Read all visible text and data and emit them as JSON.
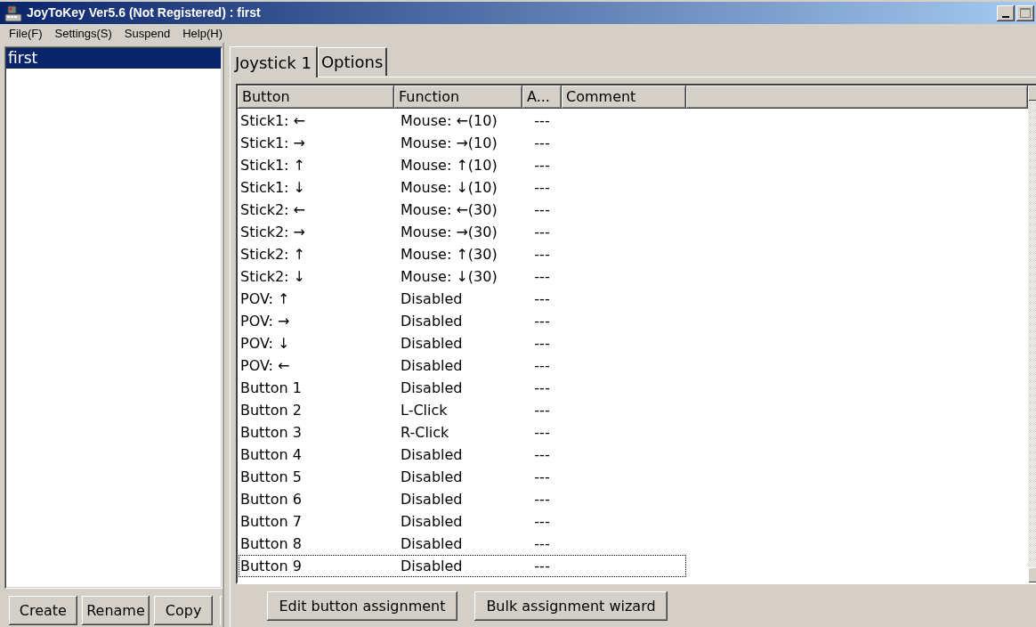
{
  "window": {
    "title": "JoyToKey Ver5.6 (Not Registered) : first"
  },
  "menu": [
    "File(F)",
    "Settings(S)",
    "Suspend",
    "Help(H)"
  ],
  "profiles": {
    "items": [
      {
        "label": "first",
        "selected": true
      }
    ],
    "buttons": [
      "Create",
      "Rename",
      "Copy"
    ]
  },
  "tabs": [
    {
      "label": "Joystick 1",
      "selected": true
    },
    {
      "label": "Options",
      "selected": false
    }
  ],
  "table": {
    "columns": [
      "Button",
      "Function",
      "A...",
      "Comment"
    ],
    "rows": [
      {
        "cells": [
          "Stick1: ←",
          "Mouse: ←(10)",
          "---"
        ],
        "focused": false
      },
      {
        "cells": [
          "Stick1: →",
          "Mouse: →(10)",
          "---"
        ],
        "focused": false
      },
      {
        "cells": [
          "Stick1: ↑",
          "Mouse: ↑(10)",
          "---"
        ],
        "focused": false
      },
      {
        "cells": [
          "Stick1: ↓",
          "Mouse: ↓(10)",
          "---"
        ],
        "focused": false
      },
      {
        "cells": [
          "Stick2: ←",
          "Mouse: ←(30)",
          "---"
        ],
        "focused": false
      },
      {
        "cells": [
          "Stick2: →",
          "Mouse: →(30)",
          "---"
        ],
        "focused": false
      },
      {
        "cells": [
          "Stick2: ↑",
          "Mouse: ↑(30)",
          "---"
        ],
        "focused": false
      },
      {
        "cells": [
          "Stick2: ↓",
          "Mouse: ↓(30)",
          "---"
        ],
        "focused": false
      },
      {
        "cells": [
          "POV: ↑",
          "Disabled",
          "---"
        ],
        "focused": false
      },
      {
        "cells": [
          "POV: →",
          "Disabled",
          "---"
        ],
        "focused": false
      },
      {
        "cells": [
          "POV: ↓",
          "Disabled",
          "---"
        ],
        "focused": false
      },
      {
        "cells": [
          "POV: ←",
          "Disabled",
          "---"
        ],
        "focused": false
      },
      {
        "cells": [
          "Button 1",
          "Disabled",
          "---"
        ],
        "focused": false
      },
      {
        "cells": [
          "Button 2",
          "L-Click",
          "---"
        ],
        "focused": false
      },
      {
        "cells": [
          "Button 3",
          "R-Click",
          "---"
        ],
        "focused": false
      },
      {
        "cells": [
          "Button 4",
          "Disabled",
          "---"
        ],
        "focused": false
      },
      {
        "cells": [
          "Button 5",
          "Disabled",
          "---"
        ],
        "focused": false
      },
      {
        "cells": [
          "Button 6",
          "Disabled",
          "---"
        ],
        "focused": false
      },
      {
        "cells": [
          "Button 7",
          "Disabled",
          "---"
        ],
        "focused": false
      },
      {
        "cells": [
          "Button 8",
          "Disabled",
          "---"
        ],
        "focused": false
      },
      {
        "cells": [
          "Button 9",
          "Disabled",
          "---"
        ],
        "focused": true
      }
    ]
  },
  "buttons": [
    "Edit button assignment",
    "Bulk assignment wizard"
  ]
}
